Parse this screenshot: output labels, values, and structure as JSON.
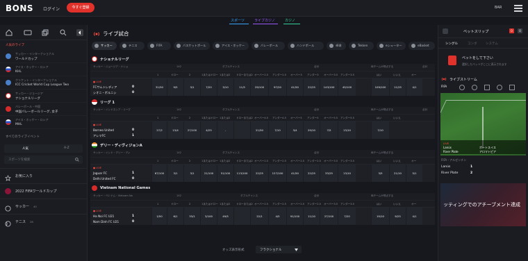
{
  "header": {
    "logo": "BONS",
    "login": "ログイン",
    "register": "今すぐ登録",
    "currency": "BAR"
  },
  "top_nav": {
    "tabs": [
      "スポーツ",
      "ライブカジノ",
      "カジノ"
    ],
    "tab_colors": [
      "#3aa7ff",
      "#9b59ff",
      "#35d39a"
    ]
  },
  "left": {
    "popular_live_title": "人気のライブ",
    "popular": [
      {
        "l1": "サッカー・インターナショナル",
        "l2": "ワールドカップ",
        "flag": "#4a7fc9"
      },
      {
        "l1": "アイス・ホッケー・ロシア",
        "l2": "KHL",
        "flag": "#d8dbe0"
      },
      {
        "l1": "クリケット・インターナショナル",
        "l2": "ICC Cricket World Cup League Two",
        "flag": "#4a7fc9"
      },
      {
        "l1": "サッカー・ジョージア",
        "l2": "ナショナルリーグ",
        "flag": "#e8e8e8"
      },
      {
        "l1": "バレーボール・中国",
        "l2": "中国バレーボールリーグ, 女子",
        "flag": "#d62b2b"
      },
      {
        "l1": "アイス・ホッケー・ロシア",
        "l2": "MHL",
        "flag": "#d8dbe0"
      }
    ],
    "all_live_title": "すべてのライブイベント",
    "az_tabs": [
      "人気",
      "A-Z"
    ],
    "search_placeholder": "スポーツを検索",
    "rows": [
      "お気に入り",
      "2022 FIFAワールドカップ",
      "サッカー",
      "テニス"
    ],
    "row_counts": [
      "",
      "",
      "40",
      "28"
    ]
  },
  "main": {
    "title": "ライブ試合",
    "sport_tabs": [
      "サッカー",
      "テニス",
      "FIFA",
      "バスケットボール",
      "アイス・ホッケー",
      "バレーボール",
      "ハンドボール",
      "卓球",
      "Tekken",
      "eシューター",
      "eBasket"
    ],
    "leagues": [
      {
        "name": "ナショナルリーグ",
        "flag": "#e8e8e8",
        "path": "サッカー・ジョージア・ナショ",
        "groups": [
          "1X2",
          "ダブルチャンス",
          "合計",
          "両チームが得点する",
          "合計"
        ],
        "subcols": [
          "1",
          "ドロー",
          "2",
          "1またはドロー",
          "1または2",
          "ドローまたは2",
          "オーバー2.5",
          "アンダー2.5",
          "オーバー3",
          "アンダー3",
          "オーバー3.5",
          "アンダー3.5",
          "はい",
          "いいえ",
          "オー"
        ],
        "matches": [
          {
            "t1": "FCサムトレディア",
            "t2": "シオニ・ボルニシ",
            "s1": "0",
            "s2": "0",
            "odds": [
              "31/50",
              "9/5",
              "3/1",
              "7/20",
              "3/10",
              "11/5",
              "29/100",
              "97/20",
              "41/50",
              "22/25",
              "143/100",
              "45/100",
              "109/100",
              "11/25",
              "4/1"
            ]
          }
        ]
      },
      {
        "name": "リーグ 1",
        "flag": "#d62b2b",
        "path": "サッカー・インドネシア・リーグ",
        "groups": [
          "1X2",
          "ダブルチャンス",
          "合計",
          "両チームが得点する",
          "合計"
        ],
        "subcols": [
          "1",
          "ドロー",
          "2",
          "1またはドロー",
          "1または2",
          "ドローまたは2",
          "オーバー4.5",
          "アンダー4.5",
          "オーバー5",
          "アンダー5",
          "オーバー5.5",
          "アンダー5.5",
          "はい",
          "いいえ"
        ],
        "matches": [
          {
            "t1": "Borneo United",
            "t2": "アレマFC",
            "s1": "0",
            "s2": "1",
            "odds": [
              "27/2",
              "13/4",
              "27/100",
              "4/25",
              "-",
              "",
              "21/50",
              "7/10",
              "3/4",
              "29/10",
              "7/5",
              "13/10",
              "7/10",
              ""
            ]
          }
        ]
      },
      {
        "name": "デリー・ディヴィジョンA",
        "flag": "#f08a24",
        "path": "サッカー・インド・デリー・ディ",
        "groups": [
          "1X2",
          "ダブルチャンス",
          "合計",
          "両チームが得点する"
        ],
        "subcols": [
          "1",
          "ドロー",
          "2",
          "1またはドロー",
          "1または2",
          "ドローまたは2",
          "オーバー2.5",
          "アンダー2.5",
          "オーバー2.5",
          "アンダー2.5",
          "オーバー3.5",
          "アンダー3.5",
          "はい",
          "いいえ",
          "オー"
        ],
        "matches": [
          {
            "t1": "Jaguar FC",
            "t2": "Delhi United FC",
            "s1": "1",
            "s2": "0",
            "odds": [
              "67/100",
              "3/1",
              "3/1",
              "21/100",
              "51/100",
              "113/100",
              "22/25",
              "127/100",
              "41/50",
              "22/25",
              "33/25",
              "13/10",
              "3/5",
              "21/10",
              "5/1"
            ]
          }
        ]
      },
      {
        "name": "Vietnam National Games",
        "flag": "#d62b2b",
        "path": "サッカー・ベトナム・Vietnam Na",
        "groups": [
          "1X2",
          "ダブルチャンス",
          "合計",
          "両チームが得点する"
        ],
        "subcols": [
          "1",
          "ドロー",
          "2",
          "1またはドロー",
          "1または2",
          "ドローまたは2",
          "オーバー2.5",
          "アンダー2.5",
          "オーバー2.5",
          "アンダー2.5",
          "オーバー3.5",
          "アンダー3.5",
          "はい",
          "いいえ",
          "オー"
        ],
        "matches": [
          {
            "t1": "Ha Noi FC U21",
            "t2": "Nam Dinh FC U21",
            "s1": "1",
            "s2": "0",
            "odds": [
              "1/50",
              "6/1",
              "33/1",
              "3/100",
              "49/5",
              "",
              "22/1",
              "4/5",
              "91/100",
              "11/10",
              "27/100",
              "7/20",
              "19/10",
              "9/25",
              "4/1"
            ]
          }
        ]
      }
    ],
    "bottom": {
      "label": "オッズ表示形式",
      "value": "フラクショナル"
    }
  },
  "right": {
    "title": "ベットスリップ",
    "badge1": "0",
    "badge2": "0",
    "tabs": [
      "シングル",
      "コンボ",
      "システム"
    ],
    "empty_text1": "ベットをして下さい",
    "empty_text2": "選択したベットがここに表示されます",
    "stream_title": "ライブストリーム",
    "stream_sport": "FIFA",
    "scoreboard": {
      "live": "LIVE",
      "team1": "Lanús",
      "team2": "River Plate",
      "team1b": "ポートスイス",
      "team2b": "アロマトピア"
    },
    "fs_title": "FIFA・アルゼンチン",
    "fs_team1": "Lanús",
    "fs_team2": "River Plate",
    "fs_s1": "1",
    "fs_s2": "2",
    "promo_text": "ッティングでのアチーブメント達成"
  }
}
